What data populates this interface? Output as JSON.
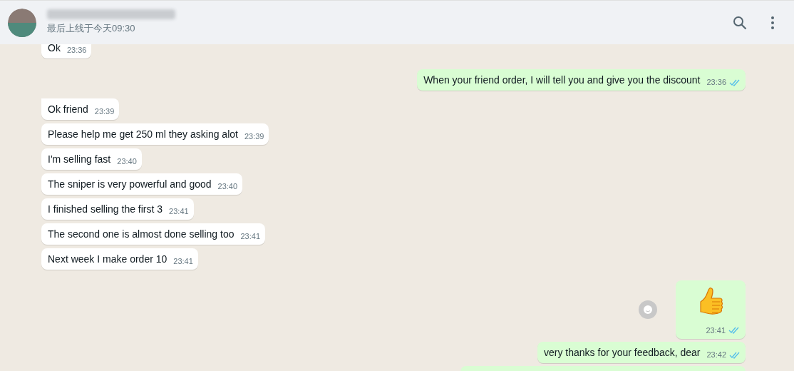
{
  "header": {
    "status": "最后上线于今天09:30"
  },
  "messages": [
    {
      "kind": "incoming",
      "text": "Ok",
      "time": "23:36"
    },
    {
      "kind": "outgoing",
      "tail": false,
      "text": "When your friend order, I will tell you and give you the discount",
      "time": "23:36",
      "read": true
    },
    {
      "kind": "incoming",
      "tail": true,
      "text": "Ok friend",
      "time": "23:39"
    },
    {
      "kind": "incoming",
      "tail": false,
      "text": "Please help me get 250 ml they asking alot",
      "time": "23:39"
    },
    {
      "kind": "incoming",
      "tail": false,
      "text": "I'm selling fast",
      "time": "23:40"
    },
    {
      "kind": "incoming",
      "tail": false,
      "text": "The sniper is very powerful and good",
      "time": "23:40"
    },
    {
      "kind": "incoming",
      "tail": false,
      "text": "I finished selling the first 3",
      "time": "23:41"
    },
    {
      "kind": "incoming",
      "tail": false,
      "text": "The second one is almost done selling too",
      "time": "23:41"
    },
    {
      "kind": "incoming",
      "tail": false,
      "text": "Next week I make order 10",
      "time": "23:41"
    },
    {
      "kind": "sticker",
      "tail": false,
      "time": "23:41",
      "read": true
    },
    {
      "kind": "outgoing",
      "tail": false,
      "text": "very thanks for your feedback, dear",
      "time": "23:42",
      "read": true
    },
    {
      "kind": "cutoff",
      "tail": false
    }
  ]
}
